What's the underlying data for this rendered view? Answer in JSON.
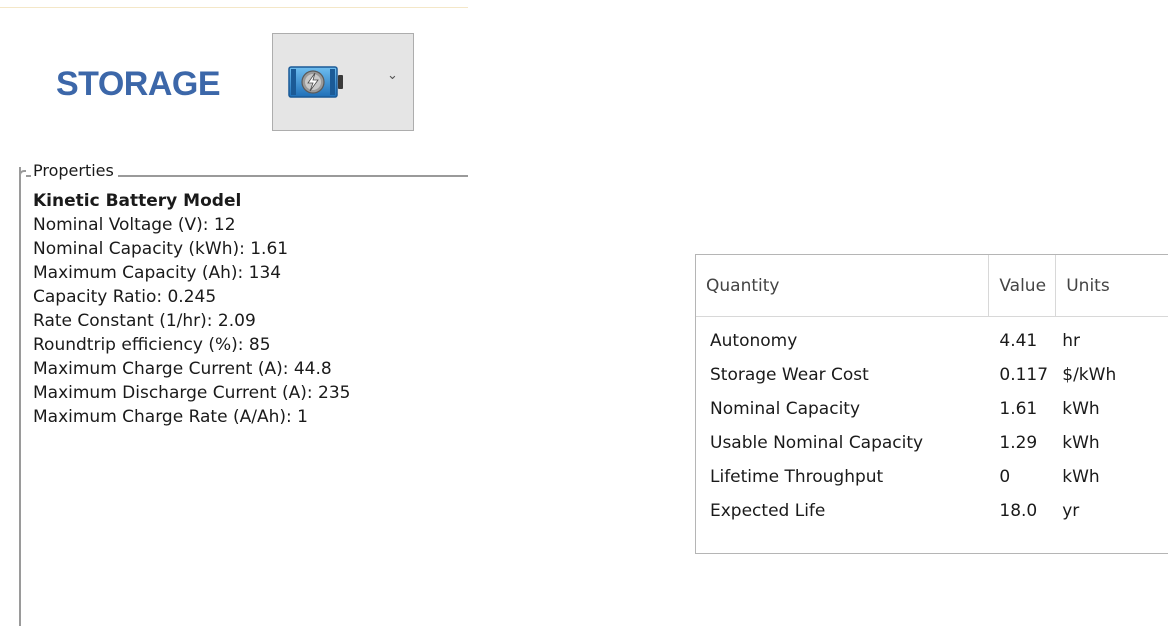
{
  "header": {
    "title": "STORAGE",
    "storage_type_icon": "battery-lightning-icon",
    "dropdown_caret_icon": "chevron-down-icon"
  },
  "properties": {
    "legend": "Properties",
    "model_title": "Kinetic Battery Model",
    "items": [
      "Nominal Voltage (V): 12",
      "Nominal Capacity (kWh): 1.61",
      "Maximum Capacity (Ah): 134",
      "Capacity Ratio: 0.245",
      "Rate Constant (1/hr): 2.09",
      "Roundtrip efficiency (%): 85",
      "Maximum Charge Current (A): 44.8",
      "Maximum Discharge Current (A): 235",
      "Maximum Charge Rate (A/Ah): 1"
    ]
  },
  "results_table": {
    "columns": [
      "Quantity",
      "Value",
      "Units"
    ],
    "rows": [
      [
        "Autonomy",
        "4.41",
        "hr"
      ],
      [
        "Storage Wear Cost",
        "0.117",
        "$/kWh"
      ],
      [
        "Nominal Capacity",
        "1.61",
        "kWh"
      ],
      [
        "Usable Nominal Capacity",
        "1.29",
        "kWh"
      ],
      [
        "Lifetime Throughput",
        "0",
        "kWh"
      ],
      [
        "Expected Life",
        "18.0",
        "yr"
      ]
    ]
  },
  "colors": {
    "title_blue": "#3c67a9",
    "icon_blue": "#2e8fd8",
    "frame_gray": "#9a9a9a"
  }
}
